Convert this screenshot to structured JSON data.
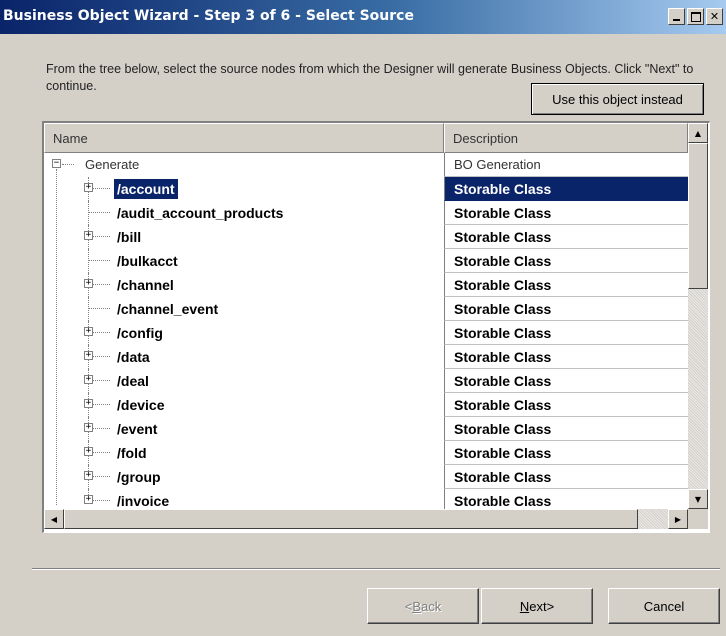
{
  "window": {
    "title": "Business Object Wizard - Step 3 of 6 - Select Source",
    "minimize_icon": "minimize-icon",
    "maximize_icon": "maximize-icon",
    "close_glyph": "✕"
  },
  "instructions": "From the tree below, select the source nodes from which the Designer will generate Business Objects. Click \"Next\" to continue.",
  "use_object_button": "Use this object instead",
  "tree": {
    "columns": {
      "name": "Name",
      "description": "Description"
    },
    "root": {
      "label": "Generate",
      "description": "BO Generation",
      "expander": "−"
    },
    "items": [
      {
        "label": "/account",
        "description": "Storable Class",
        "expandable": true,
        "selected": true
      },
      {
        "label": "/audit_account_products",
        "description": "Storable Class",
        "expandable": false
      },
      {
        "label": "/bill",
        "description": "Storable Class",
        "expandable": true
      },
      {
        "label": "/bulkacct",
        "description": "Storable Class",
        "expandable": false
      },
      {
        "label": "/channel",
        "description": "Storable Class",
        "expandable": true
      },
      {
        "label": "/channel_event",
        "description": "Storable Class",
        "expandable": false
      },
      {
        "label": "/config",
        "description": "Storable Class",
        "expandable": true
      },
      {
        "label": "/data",
        "description": "Storable Class",
        "expandable": true
      },
      {
        "label": "/deal",
        "description": "Storable Class",
        "expandable": true
      },
      {
        "label": "/device",
        "description": "Storable Class",
        "expandable": true
      },
      {
        "label": "/event",
        "description": "Storable Class",
        "expandable": true
      },
      {
        "label": "/fold",
        "description": "Storable Class",
        "expandable": true
      },
      {
        "label": "/group",
        "description": "Storable Class",
        "expandable": true
      },
      {
        "label": "/invoice",
        "description": "Storable Class",
        "expandable": true
      }
    ],
    "expand_glyph": "+"
  },
  "scrollbars": {
    "up": "▲",
    "down": "▼",
    "left": "◀",
    "right": "▶"
  },
  "buttons": {
    "back": {
      "mnemonic": "B",
      "rest": "ack",
      "prefix": "< ",
      "enabled": false
    },
    "next": {
      "mnemonic": "N",
      "rest": "ext",
      "suffix": " >",
      "enabled": true
    },
    "cancel": "Cancel"
  },
  "colors": {
    "selection": "#0a246a",
    "titlebar": "#0a246a",
    "face": "#d4d0c8"
  }
}
